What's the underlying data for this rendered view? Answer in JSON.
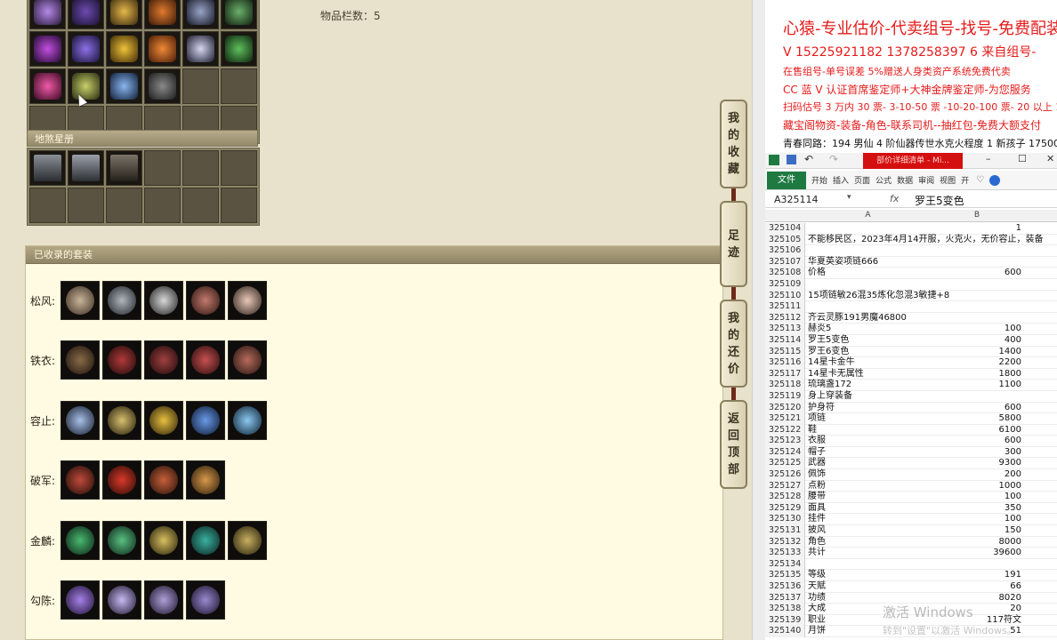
{
  "game": {
    "item_count_label": "物品栏数：5",
    "section_disha": "地煞星册",
    "section_suits": "已收录的套装",
    "side_tabs": [
      {
        "label": "我的收藏",
        "chars": [
          "我",
          "的",
          "收",
          "藏"
        ]
      },
      {
        "label": "足迹",
        "chars": [
          "足",
          "迹"
        ]
      },
      {
        "label": "我的还价",
        "chars": [
          "我",
          "的",
          "还",
          "价"
        ]
      },
      {
        "label": "返回顶部",
        "chars": [
          "返",
          "回",
          "顶",
          "部"
        ]
      }
    ],
    "suits": [
      {
        "name": "松风:",
        "count": 5
      },
      {
        "name": "铁衣:",
        "count": 5
      },
      {
        "name": "容止:",
        "count": 5
      },
      {
        "name": "破军:",
        "count": 4
      },
      {
        "name": "金麟:",
        "count": 5
      },
      {
        "name": "勾陈:",
        "count": 4
      }
    ],
    "colors": {
      "purple": "#8a3cd0",
      "gold": "#d4a21a",
      "red": "#b3271a",
      "green": "#2f9a5a",
      "blue": "#3b74c9"
    }
  },
  "ads": {
    "lines": [
      "心猿-专业估价-代卖组号-找号-免费配装",
      "V 15225921182  1378258397 6 来自组号-",
      "在售组号-单号误差 5%赠送人身类资产系统免费代卖",
      "CC 蓝 V 认证首席鉴定师+大神金牌鉴定师-为您服务",
      "扫码估号 3 万内 30 票- 3-10-50 票  -10-20-100 票- 20 以上 150",
      "藏宝阁物资-装备-角色-联系司机--抽红包-免费大额支付",
      "青春同路：194 男仙 4 阶仙器传世水克火程度 1 新孩子 17500"
    ]
  },
  "excel": {
    "title_bar": "部价详细清单 - Mi...",
    "ribbon_file": "文件",
    "ribbon_tabs": [
      "开始",
      "插入",
      "页面",
      "公式",
      "数据",
      "审阅",
      "视图",
      "开"
    ],
    "name_box": "A325114",
    "fx": "fx",
    "formula_value": "罗王5变色",
    "col_a": "A",
    "col_b": "B",
    "rows": [
      {
        "n": "325104",
        "a": "",
        "b": "1"
      },
      {
        "n": "325105",
        "a": "不能移民区，2023年4月14开服，火克火，无价容止，装备",
        "b": ""
      },
      {
        "n": "325106",
        "a": "",
        "b": ""
      },
      {
        "n": "325107",
        "a": "华夏英姿项链666",
        "b": ""
      },
      {
        "n": "325108",
        "a": "价格",
        "b": "600"
      },
      {
        "n": "325109",
        "a": "",
        "b": ""
      },
      {
        "n": "325110",
        "a": "15项链敏26混35炼化忽混3敏捷+8",
        "b": ""
      },
      {
        "n": "325111",
        "a": "",
        "b": ""
      },
      {
        "n": "325112",
        "a": "齐云灵豚191男魔46800",
        "b": ""
      },
      {
        "n": "325113",
        "a": "赫炎5",
        "b": "100"
      },
      {
        "n": "325114",
        "a": "罗王5变色",
        "b": "400"
      },
      {
        "n": "325115",
        "a": "罗王6变色",
        "b": "1400"
      },
      {
        "n": "325116",
        "a": "14星卡金牛",
        "b": "2200"
      },
      {
        "n": "325117",
        "a": "14星卡无属性",
        "b": "1800"
      },
      {
        "n": "325118",
        "a": "琉璃盏172",
        "b": "1100"
      },
      {
        "n": "325119",
        "a": "身上穿装备",
        "b": ""
      },
      {
        "n": "325120",
        "a": "护身符",
        "b": "600"
      },
      {
        "n": "325121",
        "a": "项链",
        "b": "5800"
      },
      {
        "n": "325122",
        "a": "鞋",
        "b": "6100"
      },
      {
        "n": "325123",
        "a": "衣服",
        "b": "600"
      },
      {
        "n": "325124",
        "a": "帽子",
        "b": "300"
      },
      {
        "n": "325125",
        "a": "武器",
        "b": "9300"
      },
      {
        "n": "325126",
        "a": "佩饰",
        "b": "200"
      },
      {
        "n": "325127",
        "a": "点粉",
        "b": "1000"
      },
      {
        "n": "325128",
        "a": "腰带",
        "b": "100"
      },
      {
        "n": "325129",
        "a": "面具",
        "b": "350"
      },
      {
        "n": "325130",
        "a": "挂件",
        "b": "100"
      },
      {
        "n": "325131",
        "a": "披风",
        "b": "150"
      },
      {
        "n": "325132",
        "a": "角色",
        "b": "8000"
      },
      {
        "n": "325133",
        "a": "共计",
        "b": "39600"
      },
      {
        "n": "325134",
        "a": "",
        "b": ""
      },
      {
        "n": "325135",
        "a": "等级",
        "b": "191"
      },
      {
        "n": "325136",
        "a": "天赋",
        "b": "66"
      },
      {
        "n": "325137",
        "a": "功绩",
        "b": "8020"
      },
      {
        "n": "325138",
        "a": "大成",
        "b": "20"
      },
      {
        "n": "325139",
        "a": "职业",
        "b": "117符文"
      },
      {
        "n": "325140",
        "a": "月饼",
        "b": "51"
      }
    ],
    "watermark": "激活 Windows",
    "watermark_sub": "转到\"设置\"以激活 Windows。"
  }
}
